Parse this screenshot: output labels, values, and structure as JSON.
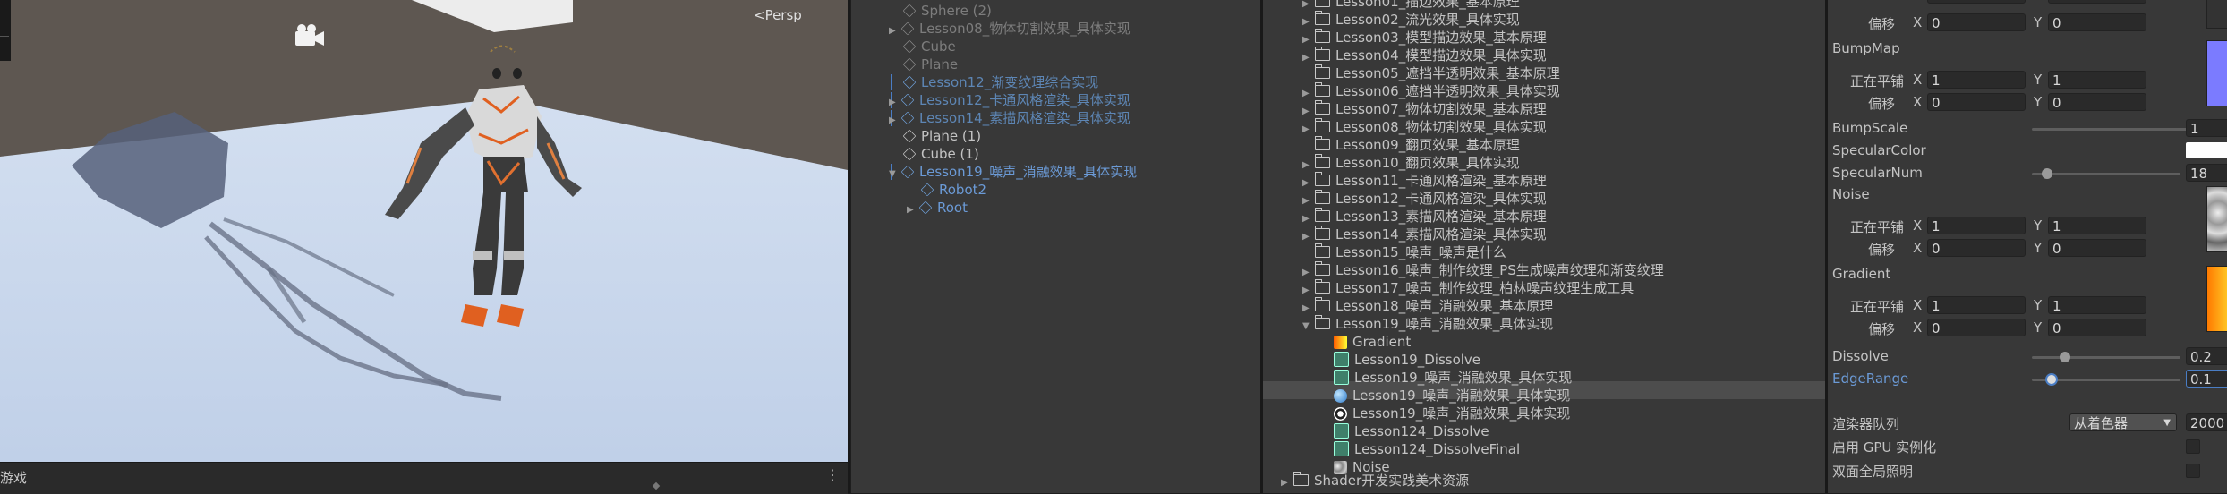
{
  "scene": {
    "persp_label": "<Persp",
    "game_tab": "游戏",
    "menu_dots": "⋮"
  },
  "hierarchy": {
    "items": [
      {
        "label": "Sphere (2)",
        "style": "grey"
      },
      {
        "label": "Lesson08_物体切割效果_具体实现",
        "style": "grey"
      },
      {
        "label": "Cube",
        "style": "grey"
      },
      {
        "label": "Plane",
        "style": "grey"
      },
      {
        "label": "Lesson12_渐变纹理综合实现",
        "style": "dimblue"
      },
      {
        "label": "Lesson12_卡通风格渲染_具体实现",
        "style": "dimblue"
      },
      {
        "label": "Lesson14_素描风格渲染_具体实现",
        "style": "dimblue"
      },
      {
        "label": "Plane (1)",
        "style": "normal"
      },
      {
        "label": "Cube (1)",
        "style": "normal"
      },
      {
        "label": "Lesson19_噪声_消融效果_具体实现",
        "style": "blue"
      },
      {
        "label": "Robot2",
        "style": "blue"
      },
      {
        "label": "Root",
        "style": "blue"
      }
    ]
  },
  "project": {
    "folders": [
      "Lesson01_描边效果_基本原理",
      "Lesson02_流光效果_具体实现",
      "Lesson03_模型描边效果_基本原理",
      "Lesson04_模型描边效果_具体实现",
      "Lesson05_遮挡半透明效果_基本原理",
      "Lesson06_遮挡半透明效果_具体实现",
      "Lesson07_物体切割效果_基本原理",
      "Lesson08_物体切割效果_具体实现",
      "Lesson09_翻页效果_基本原理",
      "Lesson10_翻页效果_具体实现",
      "Lesson11_卡通风格渲染_基本原理",
      "Lesson12_卡通风格渲染_具体实现",
      "Lesson13_素描风格渲染_基本原理",
      "Lesson14_素描风格渲染_具体实现",
      "Lesson15_噪声_噪声是什么",
      "Lesson16_噪声_制作纹理_PS生成噪声纹理和渐变纹理",
      "Lesson17_噪声_制作纹理_柏林噪声纹理生成工具",
      "Lesson18_噪声_消融效果_基本原理",
      "Lesson19_噪声_消融效果_具体实现"
    ],
    "assets": [
      {
        "label": "Gradient",
        "icon": "gradient"
      },
      {
        "label": "Lesson19_Dissolve",
        "icon": "shader"
      },
      {
        "label": "Lesson19_噪声_消融效果_具体实现",
        "icon": "shader"
      },
      {
        "label": "Lesson19_噪声_消融效果_具体实现",
        "icon": "material"
      },
      {
        "label": "Lesson19_噪声_消融效果_具体实现",
        "icon": "scene"
      },
      {
        "label": "Lesson124_Dissolve",
        "icon": "shader"
      },
      {
        "label": "Lesson124_DissolveFinal",
        "icon": "shader"
      },
      {
        "label": "Noise",
        "icon": "noise"
      }
    ],
    "bottom_folder": "Shader开发实践美术资源"
  },
  "inspector": {
    "tiling_label": "正在平铺",
    "offset_label": "偏移",
    "x_label": "X",
    "y_label": "Y",
    "top_offset": {
      "x": "0",
      "y": "0"
    },
    "bumpmap": {
      "title": "BumpMap",
      "tiling": {
        "x": "1",
        "y": "1"
      },
      "offset": {
        "x": "0",
        "y": "0"
      }
    },
    "bumpscale": {
      "label": "BumpScale",
      "value": "1",
      "fraction": 1.0
    },
    "specular_color": {
      "label": "SpecularColor"
    },
    "specular_num": {
      "label": "SpecularNum",
      "value": "18",
      "fraction": 0.07
    },
    "noise": {
      "title": "Noise",
      "tiling": {
        "x": "1",
        "y": "1"
      },
      "offset": {
        "x": "0",
        "y": "0"
      }
    },
    "gradient": {
      "title": "Gradient",
      "tiling": {
        "x": "1",
        "y": "1"
      },
      "offset": {
        "x": "0",
        "y": "0"
      }
    },
    "dissolve": {
      "label": "Dissolve",
      "value": "0.2",
      "fraction": 0.2
    },
    "edgerange": {
      "label": "EdgeRange",
      "value": "0.1",
      "fraction": 0.1
    },
    "render_queue": {
      "label": "渲染器队列",
      "option": "从着色器",
      "value": "2000"
    },
    "gpu_instancing": {
      "label": "启用 GPU 实例化"
    },
    "double_sided_gi": {
      "label": "双面全局照明"
    }
  },
  "colors": {
    "accent": "#4a7dc4",
    "bumpmap_preview": "#7b7bff",
    "gradient_start": "#ff5a00",
    "gradient_end": "#ffff33"
  }
}
